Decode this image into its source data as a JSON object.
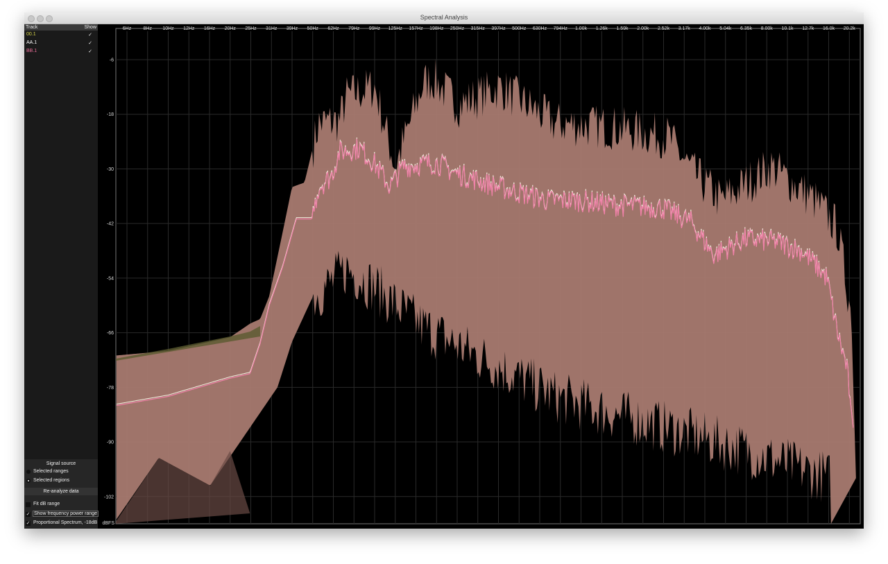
{
  "window": {
    "title": "Spectral Analysis"
  },
  "sidebar": {
    "header": {
      "track": "Track",
      "show": "Show"
    },
    "tracks": [
      {
        "name": "00.1",
        "show": "✓",
        "color": "#d9d64a"
      },
      {
        "name": "AA.1",
        "show": "✓",
        "color": "#ffffff"
      },
      {
        "name": "BB.1",
        "show": "✓",
        "color": "#ee6f9a"
      }
    ],
    "signal_source": {
      "title": "Signal source",
      "options": [
        {
          "label": "Selected ranges",
          "selected": false
        },
        {
          "label": "Selected regions",
          "selected": true
        }
      ]
    },
    "reanalyze": "Re-analyze data",
    "options": [
      {
        "label": "Fit dB range",
        "checked": false,
        "mark": ""
      },
      {
        "label": "Show frequency power range",
        "checked": true,
        "mark": "✓"
      },
      {
        "label": "Proportional Spectrum, -18dB",
        "checked": true,
        "mark": "✓"
      }
    ]
  },
  "chart_data": {
    "type": "area",
    "title": "Spectral Analysis",
    "xlabel": "Frequency",
    "ylabel": "dBFS",
    "xscale": "log",
    "xlim": [
      5.6,
      23000
    ],
    "ylim": [
      -108,
      0
    ],
    "x_ticks": [
      "6Hz",
      "8Hz",
      "10Hz",
      "12Hz",
      "16Hz",
      "20Hz",
      "25Hz",
      "31Hz",
      "39Hz",
      "50Hz",
      "62Hz",
      "79Hz",
      "99Hz",
      "125Hz",
      "157Hz",
      "198Hz",
      "250Hz",
      "315Hz",
      "397Hz",
      "500Hz",
      "630Hz",
      "794Hz",
      "1.00k",
      "1.26k",
      "1.59k",
      "2.00k",
      "2.52k",
      "3.17k",
      "4.00k",
      "5.04k",
      "6.35k",
      "8.00k",
      "10.1k",
      "12.7k",
      "16.0k",
      "20.2k"
    ],
    "y_ticks": [
      -6,
      -18,
      -30,
      -42,
      -54,
      -66,
      -78,
      -90,
      -102
    ],
    "y_unit_label": "dBFS",
    "grid": true,
    "series": [
      {
        "name": "BB.1 power range max",
        "color": "#a87a70",
        "x": [
          5.6,
          10,
          20,
          25,
          28,
          31,
          36,
          40,
          46,
          54,
          68,
          74,
          101,
          127,
          175,
          196,
          260,
          410,
          761,
          1500,
          2700,
          3600,
          4900,
          8600,
          14000,
          18000,
          21000,
          22500
        ],
        "y": [
          -71,
          -70,
          -67,
          -64,
          -63,
          -58,
          -44,
          -34,
          -33,
          -20,
          -19.5,
          -14,
          -12,
          -29.5,
          -11,
          -10.4,
          -16,
          -12,
          -20,
          -21,
          -23,
          -31,
          -37,
          -29.5,
          -37,
          -43,
          -61.5,
          -108
        ]
      },
      {
        "name": "BB.1 power range min",
        "color": "#a87a70",
        "x": [
          5.6,
          9,
          16,
          22,
          34,
          40,
          50,
          74,
          101,
          170,
          350,
          760,
          1500,
          3000,
          6500,
          16500,
          17000
        ],
        "y": [
          -107,
          -93.5,
          -99.6,
          -90.5,
          -78,
          -68,
          -58.5,
          -52,
          -56,
          -64.5,
          -72,
          -80,
          -84,
          -87.5,
          -92,
          -98,
          -108
        ]
      },
      {
        "name": "BB.1",
        "color": "#f080a8",
        "x": [
          5.6,
          10,
          20,
          25,
          28,
          31,
          36,
          42,
          50,
          54,
          62,
          68,
          85,
          100,
          120,
          140,
          200,
          250,
          400,
          700,
          1000,
          1500,
          2500,
          3500,
          4500,
          6350,
          9000,
          12000,
          14000,
          16000,
          18000,
          20000,
          21500
        ],
        "y": [
          -82,
          -80,
          -76,
          -75,
          -68.4,
          -60,
          -51.6,
          -41,
          -41,
          -34,
          -31.8,
          -26.4,
          -25.5,
          -28.7,
          -34,
          -29.5,
          -28.7,
          -31,
          -34,
          -37,
          -37,
          -38,
          -38.6,
          -41.7,
          -49,
          -45.5,
          -46,
          -48,
          -51,
          -54,
          -66,
          -73.7,
          -87
        ]
      }
    ]
  }
}
